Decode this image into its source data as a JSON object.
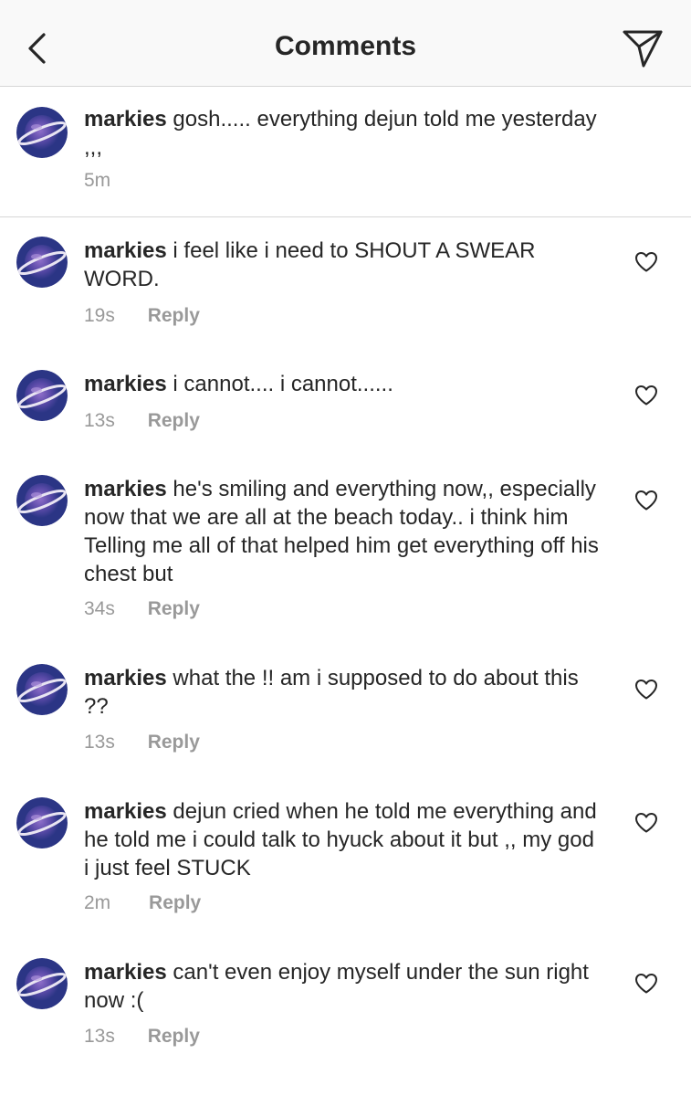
{
  "header": {
    "title": "Comments",
    "back_icon": "chevron-left-icon",
    "send_icon": "paper-plane-icon"
  },
  "caption": {
    "username": "markies",
    "text": "gosh..... everything dejun told me yesterday ,,,",
    "time": "5m"
  },
  "reply_label": "Reply",
  "comments": [
    {
      "username": "markies",
      "text": "i feel like i need to SHOUT A SWEAR WORD.",
      "time": "19s"
    },
    {
      "username": "markies",
      "text": "i cannot.... i cannot......",
      "time": "13s"
    },
    {
      "username": "markies",
      "text": "he's smiling and everything now,, especially now that we are all at the beach today.. i think him Telling me all of that helped him get everything off his chest but",
      "time": "34s"
    },
    {
      "username": "markies",
      "text": "what the !! am i supposed to do about this ??",
      "time": "13s"
    },
    {
      "username": "markies",
      "text": "dejun cried when he told me everything and he told me i could talk to hyuck about it but ,, my god i just feel STUCK",
      "time": "2m"
    },
    {
      "username": "markies",
      "text": "can't even enjoy myself under the sun right now :(",
      "time": "13s"
    }
  ],
  "colors": {
    "text": "#262626",
    "secondary": "#999999",
    "divider": "#d6d6d6",
    "header_bg": "#f9f9f9",
    "avatar_bg": "#2b3585"
  }
}
